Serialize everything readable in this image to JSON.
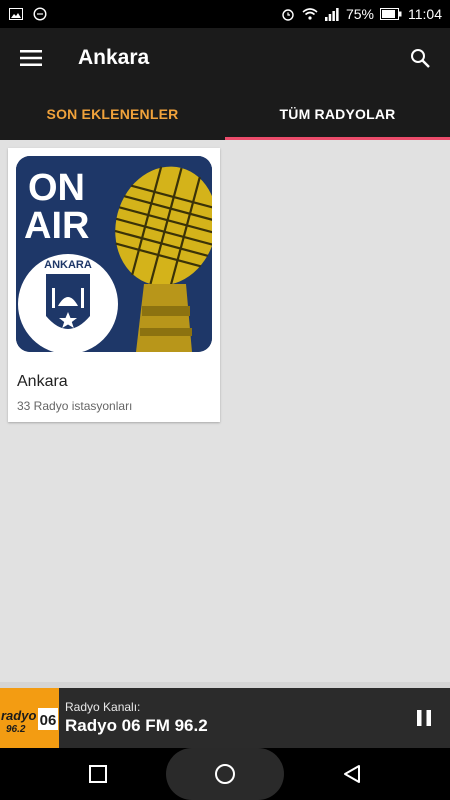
{
  "status_bar": {
    "battery": "75%",
    "time": "11:04",
    "left_icons": [
      "image-icon",
      "whatsapp-icon"
    ],
    "right_icons": [
      "alarm-icon",
      "wifi-icon",
      "signal-icon",
      "battery-icon"
    ]
  },
  "app_bar": {
    "title": "Ankara",
    "menu_icon": "menu-icon",
    "search_icon": "search-icon"
  },
  "tabs": [
    {
      "label": "SON EKLENENLER",
      "color": "#f0a23b",
      "active": false
    },
    {
      "label": "TÜM RADYOLAR",
      "color": "#ffffff",
      "active": true
    }
  ],
  "tab_indicator_color": "#ec4c6b",
  "cards": [
    {
      "title": "Ankara",
      "subtitle": "33 Radyo istasyonları",
      "art_text": {
        "line1": "ON",
        "line2": "AIR",
        "badge": "ANKARA"
      }
    }
  ],
  "player": {
    "label": "Radyo Kanalı:",
    "station": "Radyo 06 FM 96.2",
    "art_text": {
      "brand": "radyo",
      "number": "06",
      "freq": "96.2"
    },
    "state_icon": "pause-icon",
    "art_color": "#f39c12"
  },
  "nav_bar": {
    "icons": [
      "recents-icon",
      "home-icon",
      "back-icon"
    ]
  }
}
